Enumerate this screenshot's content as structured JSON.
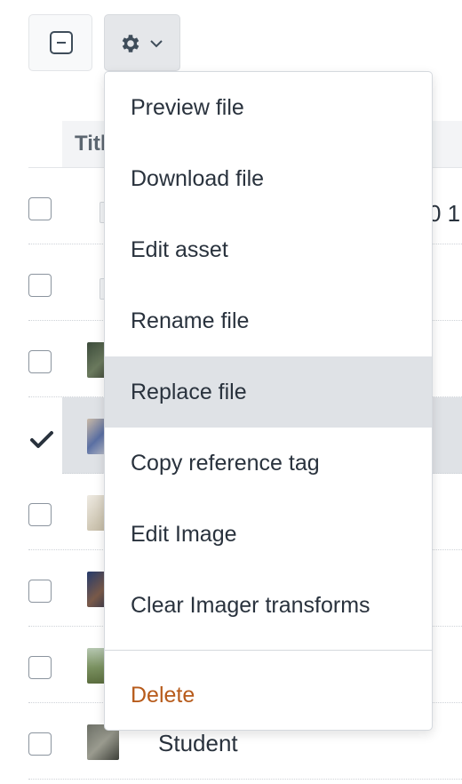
{
  "toolbar": {
    "select_all_icon": "checkbox-indeterminate-icon",
    "actions_icon": "gear-icon",
    "actions_chevron_icon": "chevron-down-icon"
  },
  "table": {
    "header": {
      "title": "Title"
    },
    "rows": [
      {
        "checked": false,
        "thumb": "placeholder",
        "side_text": "0 1"
      },
      {
        "checked": false,
        "thumb": "placeholder"
      },
      {
        "checked": false,
        "thumb": "photo"
      },
      {
        "checked": true,
        "thumb": "photo"
      },
      {
        "checked": false,
        "thumb": "photo"
      },
      {
        "checked": false,
        "thumb": "photo"
      },
      {
        "checked": false,
        "thumb": "photo"
      },
      {
        "checked": false,
        "thumb": "photo",
        "title": "Student"
      }
    ]
  },
  "menu": {
    "items": [
      {
        "label": "Preview file"
      },
      {
        "label": "Download file"
      },
      {
        "label": "Edit asset"
      },
      {
        "label": "Rename file"
      },
      {
        "label": "Replace file",
        "active": true
      },
      {
        "label": "Copy reference tag"
      },
      {
        "label": "Edit Image"
      },
      {
        "label": "Clear Imager transforms"
      }
    ],
    "delete_label": "Delete"
  },
  "colors": {
    "menu_hover": "#dfe2e6",
    "danger": "#b75b1b",
    "text": "#29323d"
  }
}
